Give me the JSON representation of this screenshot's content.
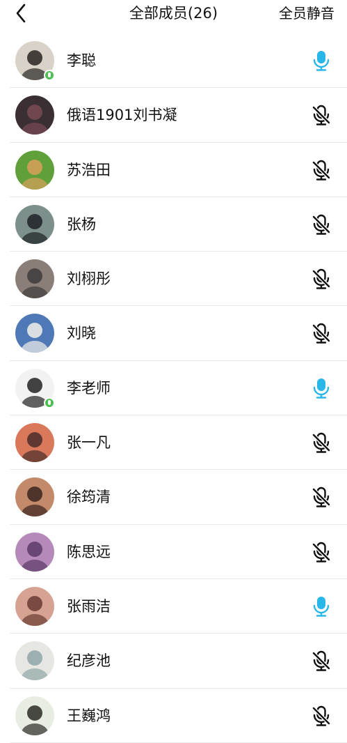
{
  "header": {
    "title": "全部成员(26)",
    "mute_all_label": "全员静音"
  },
  "colors": {
    "mic_on": "#29b6e8",
    "mic_off": "#111111",
    "speaking_badge": "#4bbf4f",
    "divider": "#e8e8e8"
  },
  "members": [
    {
      "name": "李聪",
      "mic": "on",
      "speaking": true,
      "avatar_bg": "#d8d2c8",
      "avatar_fg": "#2a2522"
    },
    {
      "name": "俄语1901刘书凝",
      "mic": "off",
      "speaking": false,
      "avatar_bg": "#3a2f33",
      "avatar_fg": "#7a4a55"
    },
    {
      "name": "苏浩田",
      "mic": "off",
      "speaking": false,
      "avatar_bg": "#5fa03a",
      "avatar_fg": "#d9a05a"
    },
    {
      "name": "张杨",
      "mic": "off",
      "speaking": false,
      "avatar_bg": "#7d8f8a",
      "avatar_fg": "#1d2227"
    },
    {
      "name": "刘栩彤",
      "mic": "off",
      "speaking": false,
      "avatar_bg": "#8a7f78",
      "avatar_fg": "#3e3b3c"
    },
    {
      "name": "刘晓",
      "mic": "off",
      "speaking": false,
      "avatar_bg": "#4f79b6",
      "avatar_fg": "#f2efe9"
    },
    {
      "name": "李老师",
      "mic": "on",
      "speaking": true,
      "avatar_bg": "#f2f2f2",
      "avatar_fg": "#222222"
    },
    {
      "name": "张一凡",
      "mic": "off",
      "speaking": false,
      "avatar_bg": "#d9785a",
      "avatar_fg": "#4a2d2a"
    },
    {
      "name": "徐筠清",
      "mic": "off",
      "speaking": false,
      "avatar_bg": "#c28a6a",
      "avatar_fg": "#3a2420"
    },
    {
      "name": "陈思远",
      "mic": "off",
      "speaking": false,
      "avatar_bg": "#b68ab8",
      "avatar_fg": "#5c3a6a"
    },
    {
      "name": "张雨洁",
      "mic": "on",
      "speaking": false,
      "avatar_bg": "#d6a393",
      "avatar_fg": "#6a3a32"
    },
    {
      "name": "纪彦池",
      "mic": "off",
      "speaking": false,
      "avatar_bg": "#e6e6e2",
      "avatar_fg": "#8fa6a8"
    },
    {
      "name": "王巍鸿",
      "mic": "off",
      "speaking": false,
      "avatar_bg": "#e8ede4",
      "avatar_fg": "#2a2a24"
    }
  ]
}
